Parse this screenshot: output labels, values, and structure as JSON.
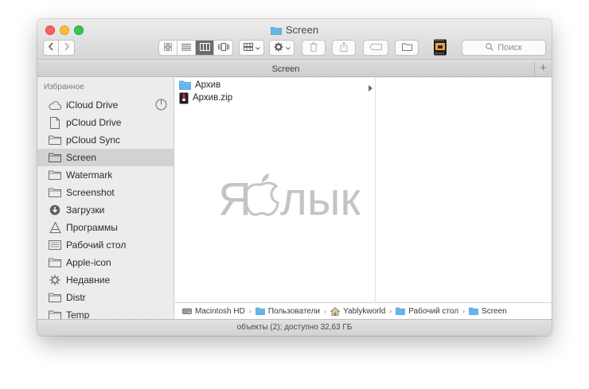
{
  "window": {
    "title": "Screen"
  },
  "toolbar": {
    "back_icon": "chevron-left-icon",
    "forward_icon": "chevron-right-icon",
    "view_modes": [
      "icon-view-icon",
      "list-view-icon",
      "column-view-icon",
      "coverflow-view-icon"
    ],
    "active_view": "column-view-icon",
    "arrange_icon": "arrange-grid-icon",
    "action_icon": "gear-icon",
    "delete_icon": "trash-icon",
    "share_icon": "share-icon",
    "tags_icon": "tag-icon",
    "new_folder_icon": "folder-icon",
    "app_icon": "filmstrip-app-icon",
    "search_placeholder": "Поиск"
  },
  "tabbar": {
    "tab_label": "Screen",
    "add_label": "+"
  },
  "sidebar": {
    "heading": "Избранное",
    "items": [
      {
        "label": "iCloud Drive",
        "icon": "cloud-icon"
      },
      {
        "label": "pCloud Drive",
        "icon": "document-icon"
      },
      {
        "label": "pCloud Sync",
        "icon": "folder-icon"
      },
      {
        "label": "Screen",
        "icon": "folder-icon"
      },
      {
        "label": "Watermark",
        "icon": "folder-icon"
      },
      {
        "label": "Screenshot",
        "icon": "folder-icon"
      },
      {
        "label": "Загрузки",
        "icon": "download-icon"
      },
      {
        "label": "Программы",
        "icon": "applications-icon"
      },
      {
        "label": "Рабочий стол",
        "icon": "desktop-icon"
      },
      {
        "label": "Apple-icon",
        "icon": "folder-icon"
      },
      {
        "label": "Недавние",
        "icon": "recents-gear-icon"
      },
      {
        "label": "Distr",
        "icon": "folder-icon"
      },
      {
        "label": "Temp",
        "icon": "folder-icon"
      }
    ],
    "selected": "Screen"
  },
  "files": [
    {
      "name": "Архив",
      "icon": "folder-icon",
      "has_children": true
    },
    {
      "name": "Архив.zip",
      "icon": "zip-archive-icon",
      "has_children": false
    }
  ],
  "watermark": {
    "text_left": "Я",
    "text_right": "лык"
  },
  "pathbar": {
    "crumbs": [
      {
        "label": "Macintosh HD",
        "icon": "hard-drive-icon"
      },
      {
        "label": "Пользователи",
        "icon": "folder-icon"
      },
      {
        "label": "Yablykworld",
        "icon": "home-icon"
      },
      {
        "label": "Рабочий стол",
        "icon": "folder-icon"
      },
      {
        "label": "Screen",
        "icon": "folder-icon"
      }
    ]
  },
  "status": {
    "text": "объекты (2); доступно 32,63 ГБ"
  },
  "colors": {
    "folder_blue": "#66b5ea",
    "selection": "#d2d2d2",
    "watermark": "#c4c4c4"
  }
}
